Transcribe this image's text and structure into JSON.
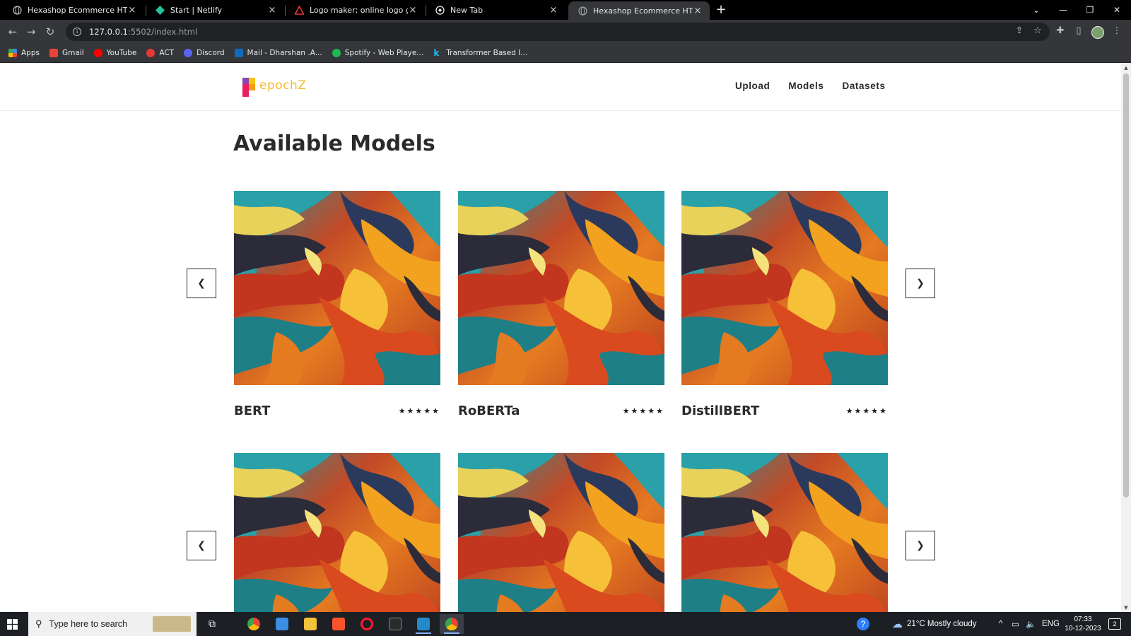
{
  "browser": {
    "tabs": [
      {
        "title": "Hexashop Ecommerce HTML CSS",
        "icon": "globe-icon",
        "active": false
      },
      {
        "title": "Start | Netlify",
        "icon": "netlify-icon",
        "active": false
      },
      {
        "title": "Logo maker; online logo generator",
        "icon": "logo-maker-icon",
        "active": false
      },
      {
        "title": "New Tab",
        "icon": "chrome-icon",
        "active": false
      },
      {
        "title": "Hexashop Ecommerce HTML CSS",
        "icon": "globe-icon",
        "active": true
      }
    ],
    "url_host": "127.0.0.1",
    "url_path": ":5502/index.html",
    "bookmarks": [
      {
        "label": "Apps",
        "icon": "apps-grid-icon",
        "color": "#4285f4"
      },
      {
        "label": "Gmail",
        "icon": "gmail-icon",
        "color": "#ea4335"
      },
      {
        "label": "YouTube",
        "icon": "youtube-icon",
        "color": "#ff0000"
      },
      {
        "label": "ACT",
        "icon": "act-icon",
        "color": "#e53935"
      },
      {
        "label": "Discord",
        "icon": "discord-icon",
        "color": "#5865f2"
      },
      {
        "label": "Mail - Dharshan .A...",
        "icon": "outlook-icon",
        "color": "#0f6cbd"
      },
      {
        "label": "Spotify - Web Playe...",
        "icon": "spotify-icon",
        "color": "#1db954"
      },
      {
        "label": "Transformer Based I...",
        "icon": "kaggle-icon",
        "color": "#20beff"
      }
    ]
  },
  "site": {
    "logo_text": "epochZ",
    "nav": [
      "Upload",
      "Models",
      "Datasets"
    ],
    "section_title": "Available Models",
    "models_row1": [
      {
        "name": "BERT",
        "rating": "★★★★★"
      },
      {
        "name": "RoBERTa",
        "rating": "★★★★★"
      },
      {
        "name": "DistillBERT",
        "rating": "★★★★★"
      }
    ]
  },
  "taskbar": {
    "search_placeholder": "Type here to search",
    "weather": "21°C  Mostly cloudy",
    "language": "ENG",
    "time": "07:33",
    "date": "10-12-2023",
    "notifications": "2"
  },
  "colors": {
    "accent_logo": "#f5b82e",
    "text_dark": "#2a2a2a"
  }
}
